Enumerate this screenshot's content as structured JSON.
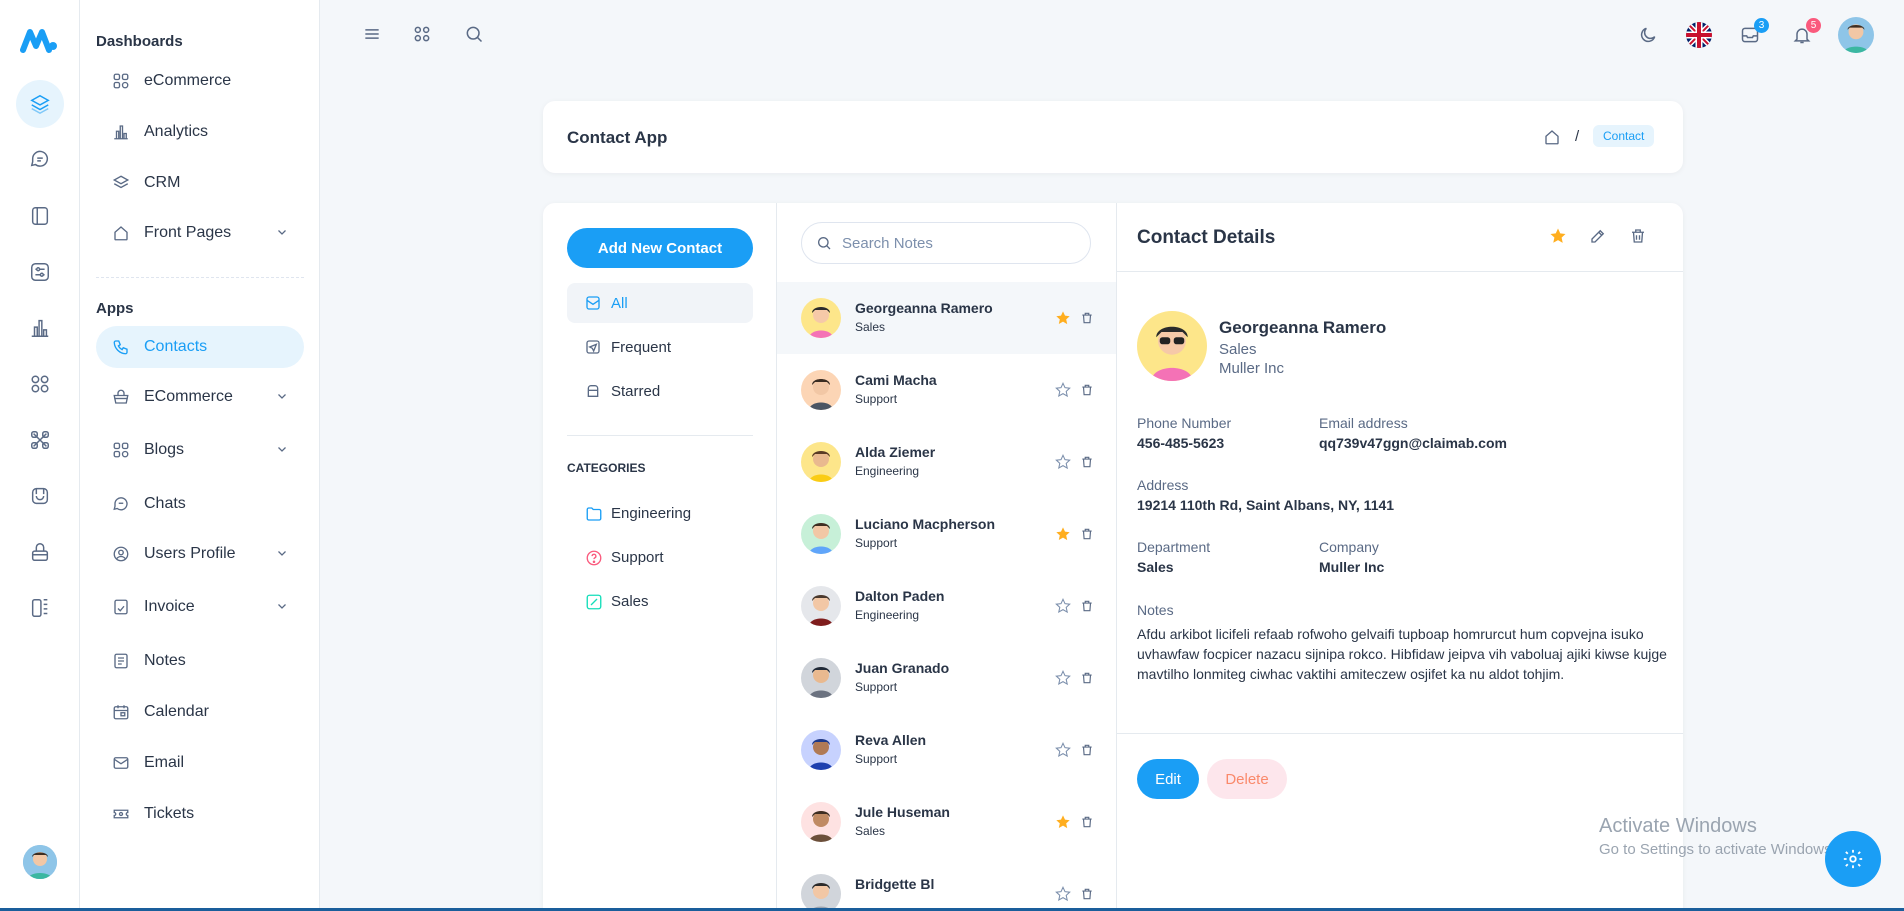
{
  "sidebar": {
    "section_dashboards": "Dashboards",
    "dashboards": [
      {
        "label": "eCommerce",
        "icon": "widgets-icon"
      },
      {
        "label": "Analytics",
        "icon": "chart-icon"
      },
      {
        "label": "CRM",
        "icon": "layers-icon"
      },
      {
        "label": "Front Pages",
        "icon": "home-icon",
        "expandable": true
      }
    ],
    "section_apps": "Apps",
    "apps": [
      {
        "label": "Contacts",
        "icon": "phone-icon",
        "active": true
      },
      {
        "label": "ECommerce",
        "icon": "basket-icon",
        "expandable": true
      },
      {
        "label": "Blogs",
        "icon": "widgets-icon",
        "expandable": true
      },
      {
        "label": "Chats",
        "icon": "chat-icon"
      },
      {
        "label": "Users Profile",
        "icon": "user-circle-icon",
        "expandable": true
      },
      {
        "label": "Invoice",
        "icon": "invoice-icon",
        "expandable": true
      },
      {
        "label": "Notes",
        "icon": "notes-icon"
      },
      {
        "label": "Calendar",
        "icon": "calendar-icon"
      },
      {
        "label": "Email",
        "icon": "mail-icon"
      },
      {
        "label": "Tickets",
        "icon": "ticket-icon"
      }
    ]
  },
  "topbar": {
    "messages_count": "3",
    "notifications_count": "5"
  },
  "breadcrumb": {
    "title": "Contact App",
    "separator": "/",
    "current": "Contact"
  },
  "contacts_panel": {
    "add_button": "Add New Contact",
    "filters": [
      {
        "label": "All",
        "active": true
      },
      {
        "label": "Frequent"
      },
      {
        "label": "Starred"
      }
    ],
    "categories_heading": "CATEGORIES",
    "categories": [
      {
        "label": "Engineering",
        "color": "#1a9ef5"
      },
      {
        "label": "Support",
        "color": "#fa5a7d"
      },
      {
        "label": "Sales",
        "color": "#13deb9"
      }
    ]
  },
  "search": {
    "placeholder": "Search Notes"
  },
  "contacts": [
    {
      "name": "Georgeanna Ramero",
      "dept": "Sales",
      "starred": true,
      "active": true
    },
    {
      "name": "Cami Macha",
      "dept": "Support",
      "starred": false
    },
    {
      "name": "Alda Ziemer",
      "dept": "Engineering",
      "starred": false
    },
    {
      "name": "Luciano Macpherson",
      "dept": "Support",
      "starred": true
    },
    {
      "name": "Dalton Paden",
      "dept": "Engineering",
      "starred": false
    },
    {
      "name": "Juan Granado",
      "dept": "Support",
      "starred": false
    },
    {
      "name": "Reva Allen",
      "dept": "Support",
      "starred": false
    },
    {
      "name": "Jule Huseman",
      "dept": "Sales",
      "starred": true
    },
    {
      "name": "Bridgette Bl",
      "dept": "",
      "starred": false
    }
  ],
  "details": {
    "heading": "Contact Details",
    "name": "Georgeanna Ramero",
    "dept": "Sales",
    "company": "Muller Inc",
    "phone_label": "Phone Number",
    "phone": "456-485-5623",
    "email_label": "Email address",
    "email": "qq739v47ggn@claimab.com",
    "address_label": "Address",
    "address": "19214 110th Rd, Saint Albans, NY, 1141",
    "department_label": "Department",
    "department": "Sales",
    "company_label": "Company",
    "company_value": "Muller Inc",
    "notes_label": "Notes",
    "notes": "Afdu arkibot licifeli refaab rofwoho gelvaifi tupboap homrurcut hum copvejna isuko uvhawfaw focpicer nazacu sijnipa rokco. Hibfidaw jeipva vih vaboluaj ajiki kiwse kujge mavtilho lonmiteg ciwhac vaktihi amiteczew osjifet ka nu aldot tohjim.",
    "edit_button": "Edit",
    "delete_button": "Delete"
  },
  "watermark": {
    "title": "Activate Windows",
    "subtitle": "Go to Settings to activate Windows."
  },
  "colors": {
    "primary": "#1a9ef5",
    "star": "#ffae1f",
    "danger_bg": "#fde6ec"
  }
}
